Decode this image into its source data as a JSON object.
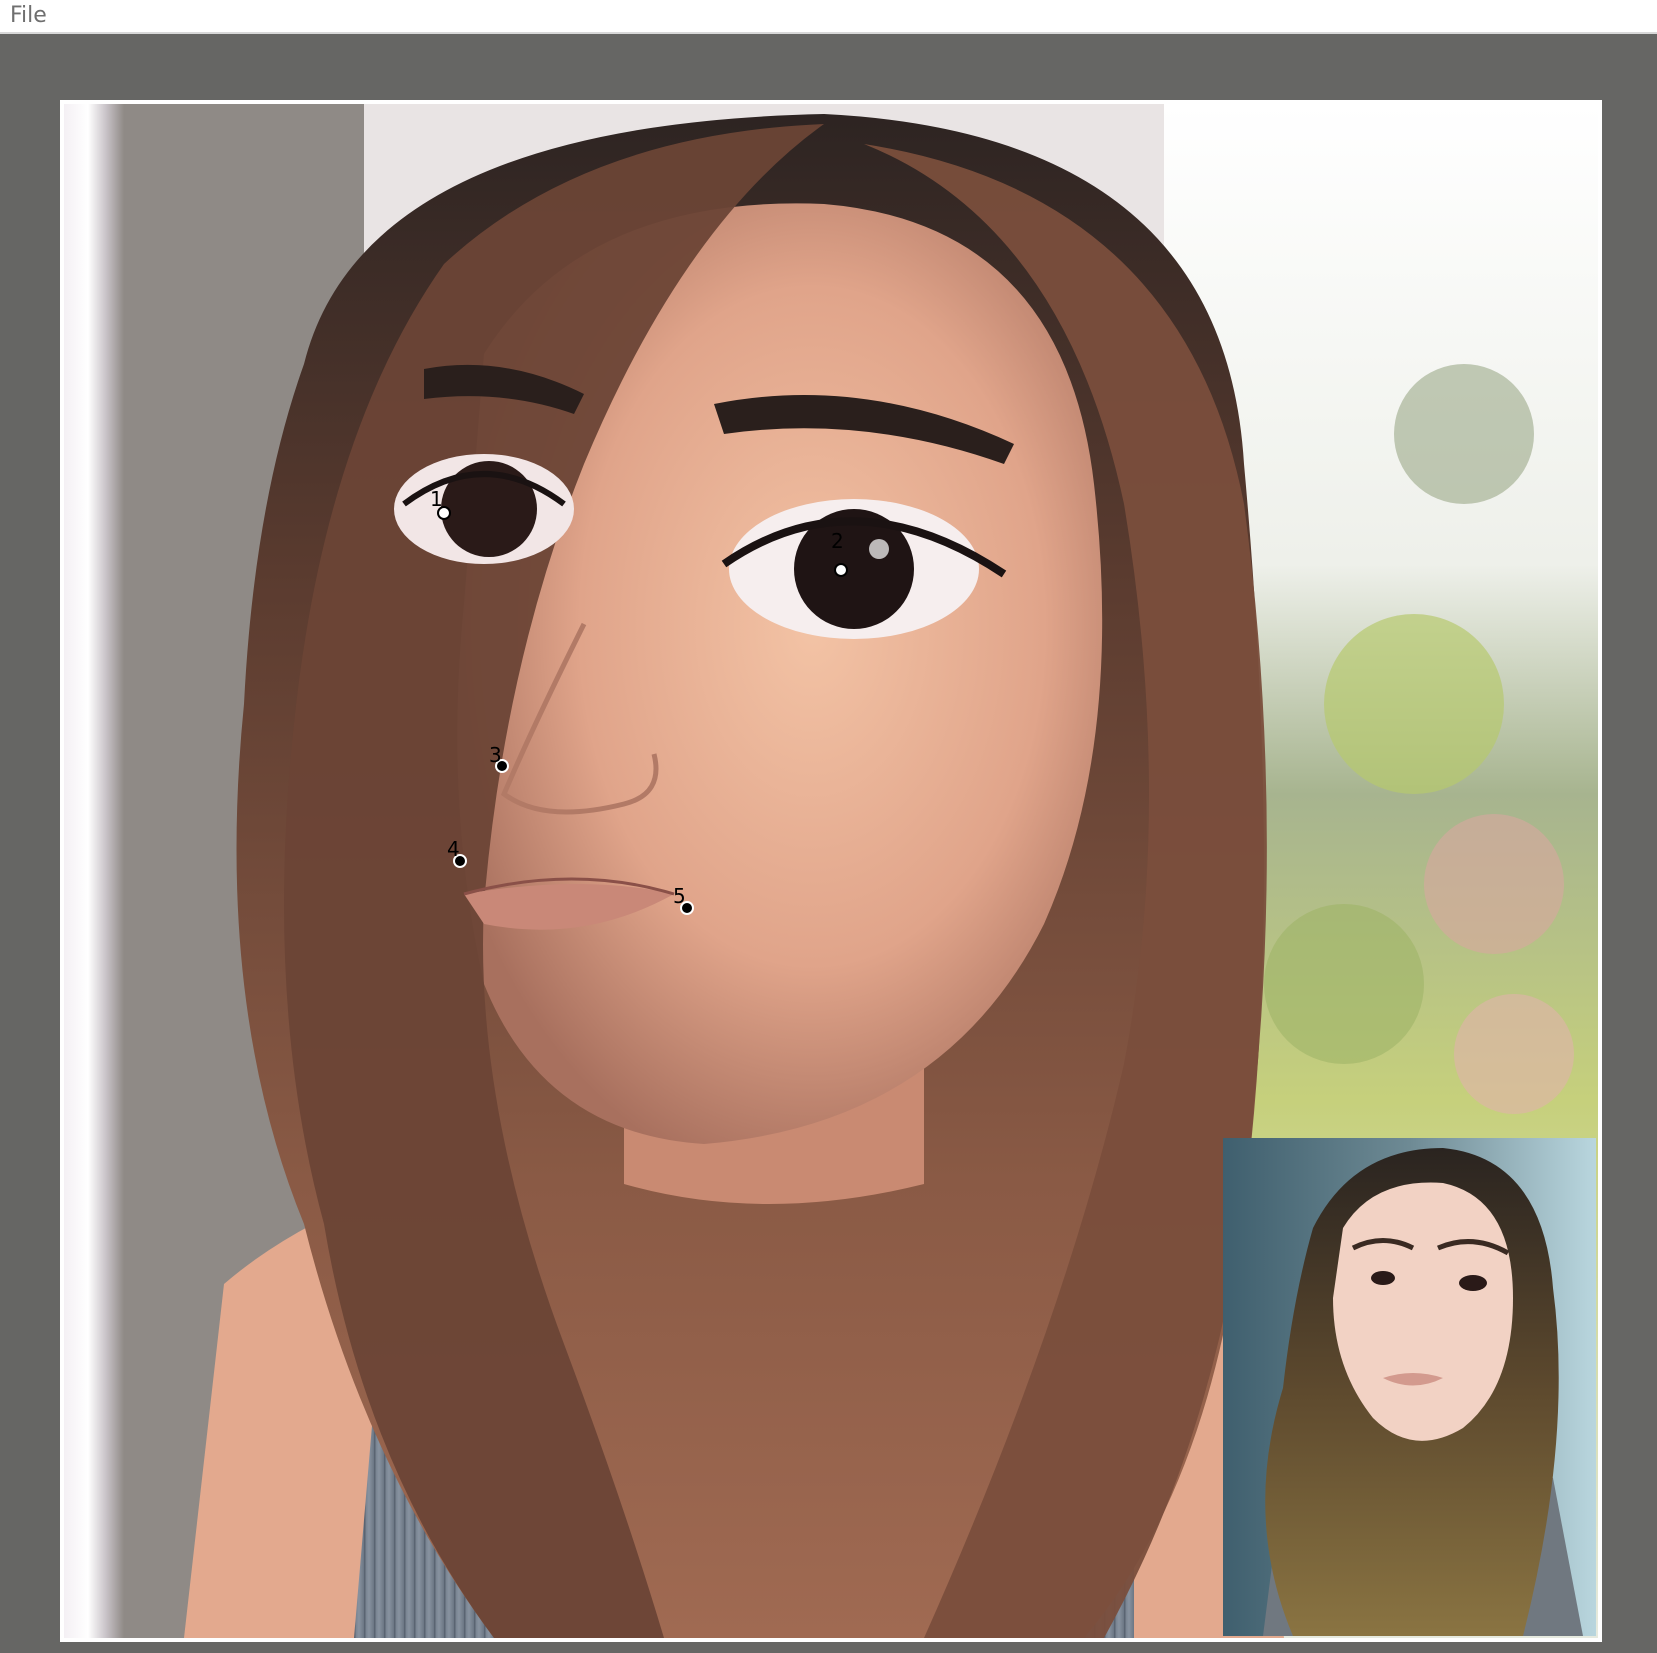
{
  "menubar": {
    "items": [
      {
        "label": "File"
      }
    ]
  },
  "main_image": {
    "description_icon": "cartoon-portrait-image",
    "landmarks": [
      {
        "label": "1"
      },
      {
        "label": "2"
      },
      {
        "label": "3"
      },
      {
        "label": "4"
      },
      {
        "label": "5"
      }
    ]
  },
  "reference_thumbnail": {
    "icon": "reference-photo-thumbnail"
  },
  "colors": {
    "workspace_bg": "#666664",
    "menubar_bg": "#ffffff",
    "menu_text": "#6f6f6f",
    "landmark_fill": "#000000"
  }
}
